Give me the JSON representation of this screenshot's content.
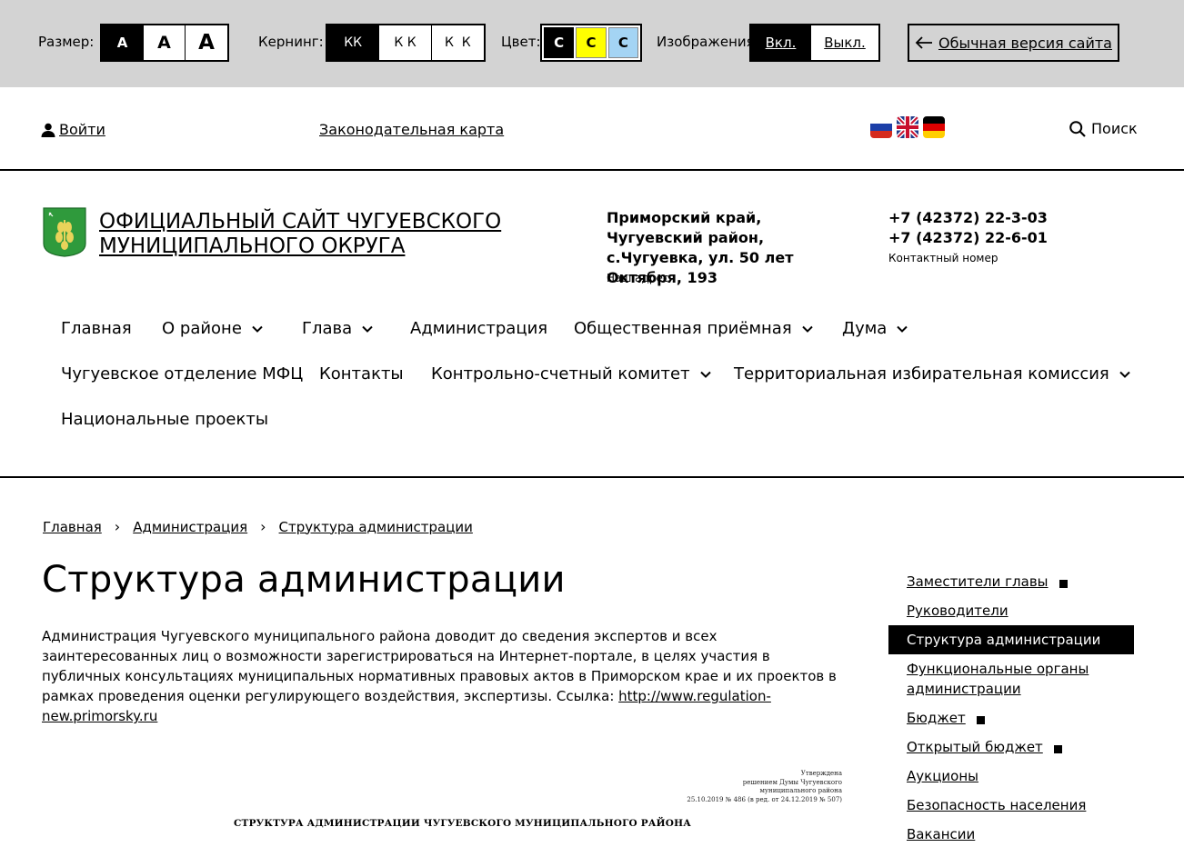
{
  "a11y": {
    "size_label": "Размер:",
    "size_options": [
      "A",
      "A",
      "A"
    ],
    "kerning_label": "Кернинг:",
    "kerning_options": [
      "КК",
      "К К",
      "К  К"
    ],
    "color_label": "Цвет:",
    "color_options": [
      "C",
      "C",
      "C"
    ],
    "images_label": "Изображения",
    "images_on": "Вкл.",
    "images_off": "Выкл.",
    "normal_version": "Обычная версия сайта"
  },
  "topbar": {
    "login": "Войти",
    "legal_map": "Законодательная карта",
    "search": "Поиск",
    "flags": [
      "flag-ru-icon",
      "flag-uk-icon",
      "flag-de-icon"
    ]
  },
  "header": {
    "title": "Официальный сайт Чугуевского муниципального округа",
    "address": "Приморский край, Чугуевский район, с.Чугуевка, ул. 50 лет Октября, 193",
    "address_caption": "Наш адрес",
    "phones": [
      "+7 (42372) 22-3-03",
      "+7 (42372) 22-6-01"
    ],
    "phone_caption": "Контактный номер"
  },
  "nav": {
    "items": [
      {
        "label": "Главная"
      },
      {
        "label": "О районе"
      },
      {
        "label": "Глава"
      },
      {
        "label": "Администрация"
      },
      {
        "label": "Общественная приёмная"
      },
      {
        "label": "Дума"
      },
      {
        "label": "Чугуевское отделение МФЦ"
      },
      {
        "label": "Контакты"
      },
      {
        "label": "Контрольно-счетный комитет"
      },
      {
        "label": "Территориальная избирательная комиссия"
      },
      {
        "label": "Национальные проекты"
      }
    ]
  },
  "breadcrumb": [
    "Главная",
    "Администрация",
    "Структура администрации"
  ],
  "breadcrumb_sep": "›",
  "main": {
    "title": "Структура администрации",
    "intro": "Администрация Чугуевского муниципального района доводит до сведения экспертов и всех заинтересованных лиц о возможности зарегистрироваться на Интернет-портале, в целях участия в публичных консультациях муниципальных нормативных правовых актов в Приморском крае и их проектов в рамках проведения оценки регулирующего воздействия, экспертизы. Ссылка: ",
    "link": "http://www.regulation-new.primorsky.ru",
    "doc_approve": [
      "Утверждена",
      "решением Думы Чугуевского",
      "муниципального района",
      "25.10.2019 № 486 (в ред. от 24.12.2019 № 507)"
    ],
    "doc_heading": "СТРУКТУРА АДМИНИСТРАЦИИ ЧУГУЕВСКОГО МУНИЦИПАЛЬНОГО РАЙОНА"
  },
  "sidemenu": [
    {
      "label": "Заместители главы",
      "submenu": true
    },
    {
      "label": "Руководители",
      "submenu": false
    },
    {
      "label": "Структура администрации",
      "submenu": false,
      "active": true
    },
    {
      "label": "Функциональные органы администрации",
      "submenu": false
    },
    {
      "label": "Бюджет",
      "submenu": true
    },
    {
      "label": "Открытый бюджет",
      "submenu": true
    },
    {
      "label": "Аукционы",
      "submenu": false
    },
    {
      "label": "Безопасность населения",
      "submenu": false
    },
    {
      "label": "Вакансии",
      "submenu": false
    }
  ]
}
